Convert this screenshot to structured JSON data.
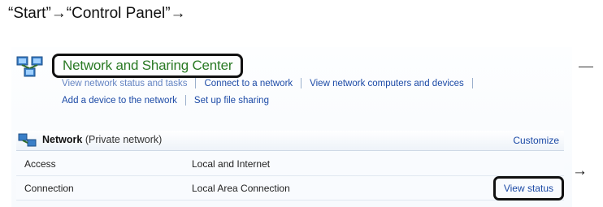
{
  "instruction": "“Start”→“Control Panel”→",
  "header": {
    "title": "Network and Sharing Center",
    "links_row1": [
      "View network status and tasks",
      "Connect to a network",
      "View network computers and devices"
    ],
    "links_row2": [
      "Add a device to the network",
      "Set up file sharing"
    ]
  },
  "network_panel": {
    "name": "Network",
    "type": "(Private network)",
    "customize_label": "Customize",
    "rows": [
      {
        "label": "Access",
        "value": "Local and Internet"
      },
      {
        "label": "Connection",
        "value": "Local Area Connection",
        "action": "View status"
      }
    ]
  },
  "trailing_arrow": "→",
  "colors": {
    "title_green": "#2a7a24",
    "link_blue": "#1c4aa6",
    "highlight_border": "#111111"
  },
  "icons": [
    "network-center-icon",
    "network-icon"
  ]
}
